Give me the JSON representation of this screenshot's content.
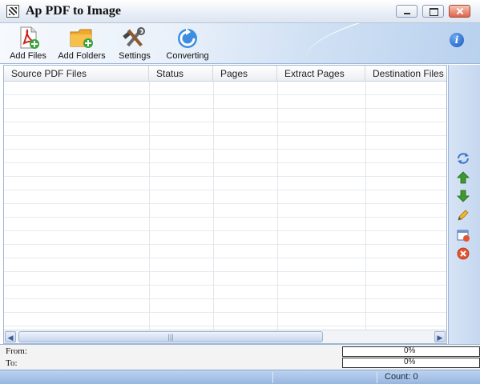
{
  "window": {
    "title": "Ap PDF to Image"
  },
  "toolbar": {
    "items": [
      {
        "label": "Add Files",
        "icon": "pdf-add-icon"
      },
      {
        "label": "Add Folders",
        "icon": "folder-add-icon"
      },
      {
        "label": "Settings",
        "icon": "tools-icon"
      },
      {
        "label": "Converting",
        "icon": "refresh-icon"
      }
    ],
    "info_icon": "info-icon"
  },
  "file_list": {
    "columns": [
      "Source PDF Files",
      "Status",
      "Pages",
      "Extract Pages",
      "Destination Files"
    ],
    "rows": []
  },
  "side_actions": [
    "refresh-icon",
    "move-up-icon",
    "move-down-icon",
    "edit-icon",
    "clear-icon",
    "delete-icon"
  ],
  "progress": {
    "from_label": "From:",
    "to_label": "To:",
    "from_percent": "0%",
    "to_percent": "0%",
    "from_value": 0.0,
    "to_value": 0.0
  },
  "status": {
    "count_text": "Count: 0"
  },
  "colors": {
    "accent": "#1657bf",
    "toolbar_edge": "#b8d1ee",
    "statusbar": "#97b6e0"
  }
}
